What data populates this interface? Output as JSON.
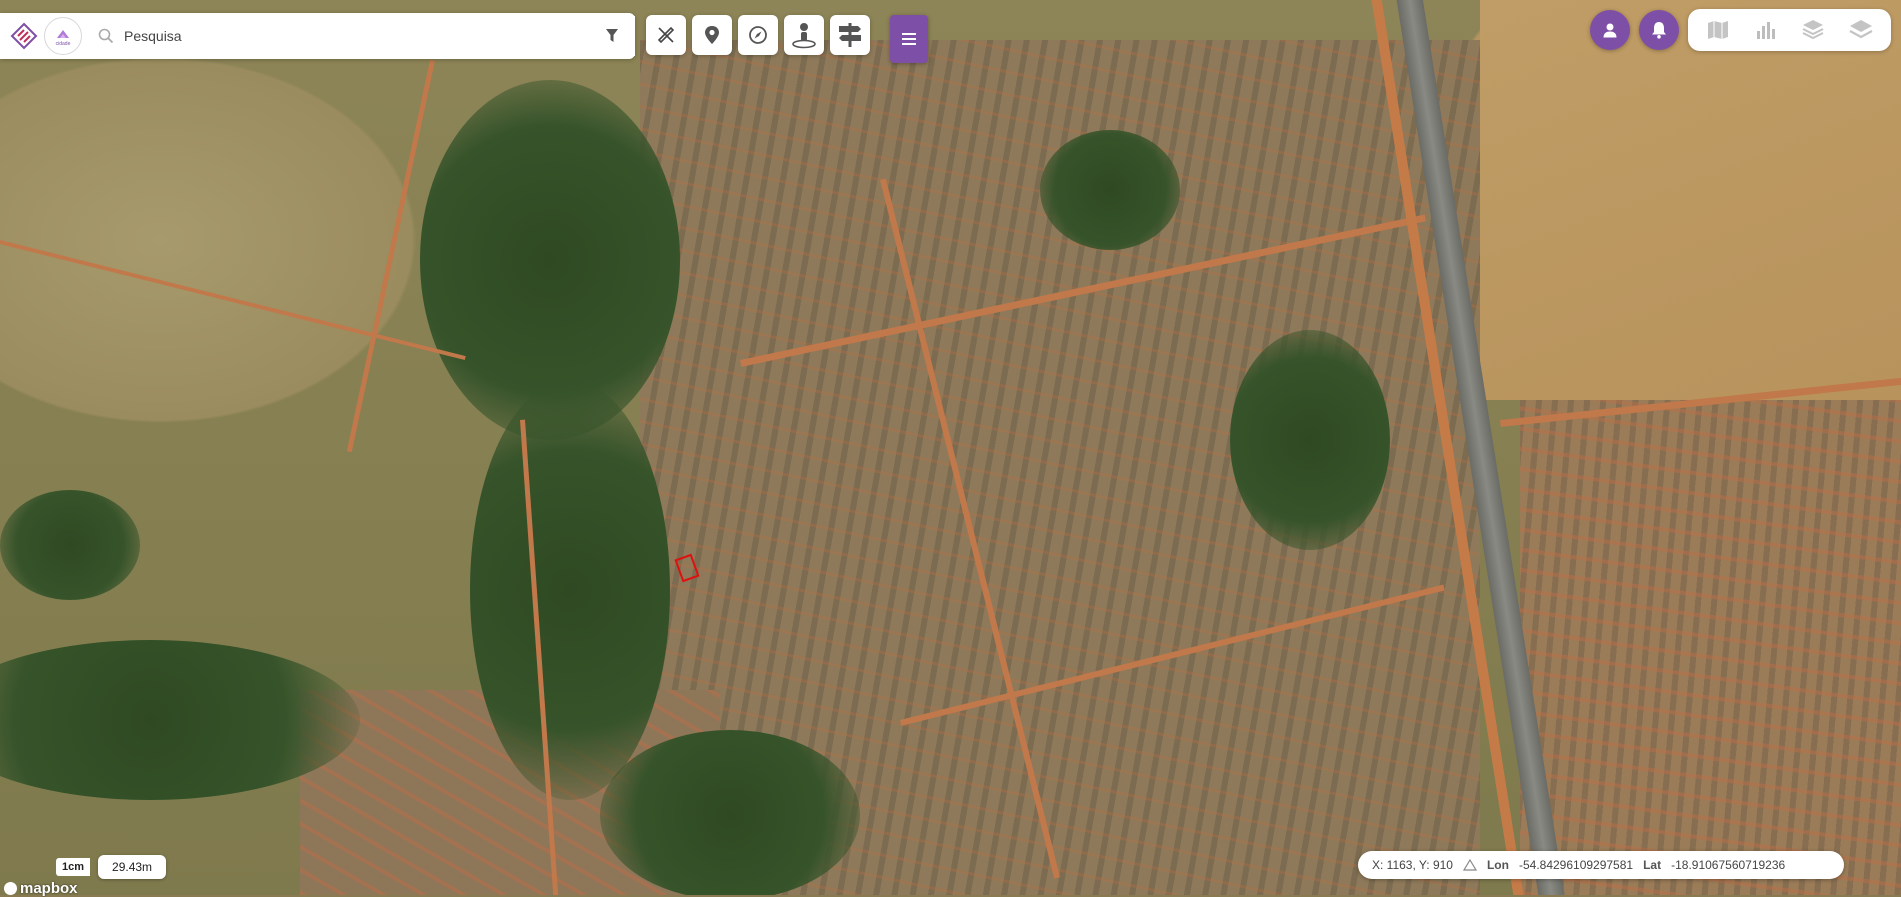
{
  "search": {
    "placeholder": "Pesquisa",
    "value": ""
  },
  "org_logo_text": "cidade",
  "toolbar": {
    "tools": [
      {
        "name": "measure-tool",
        "icon": "ruler-pencil-icon"
      },
      {
        "name": "marker-tool",
        "icon": "map-pin-icon"
      },
      {
        "name": "compass-tool",
        "icon": "compass-icon"
      },
      {
        "name": "streetview-tool",
        "icon": "person-pin-icon"
      },
      {
        "name": "signpost-tool",
        "icon": "signpost-icon"
      }
    ],
    "menu_icon": "hamburger-icon"
  },
  "right_controls": {
    "user_icon": "user-icon",
    "notification_icon": "bell-icon",
    "layers": [
      "map-icon",
      "chart-icon",
      "layers-stack-icon",
      "layers-icon"
    ]
  },
  "scale": {
    "unit_label": "1cm",
    "distance": "29.43m"
  },
  "attribution": "mapbox",
  "coordinates": {
    "xy": "X: 1163, Y: 910",
    "lon_label": "Lon",
    "lon_value": "-54.84296109297581",
    "lat_label": "Lat",
    "lat_value": "-18.91067560719236"
  },
  "colors": {
    "accent": "#7e4fa6",
    "parcel_outline": "#e01010"
  }
}
